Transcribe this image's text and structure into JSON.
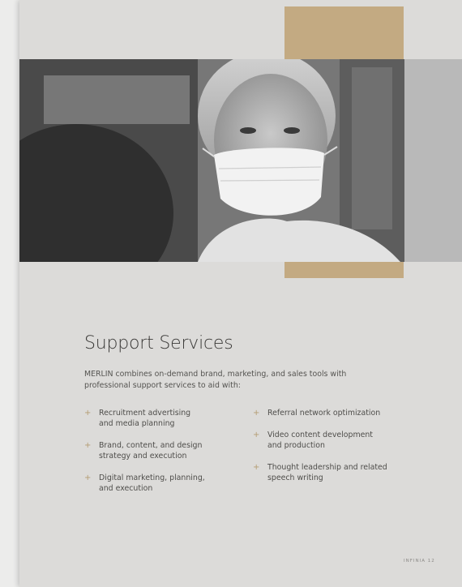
{
  "page": {
    "title": "Support Services",
    "intro": "MERLIN combines on-demand brand, marketing, and sales tools with professional support services to aid with:",
    "services_left": [
      {
        "bullet": "+",
        "text": "Recruitment advertising\nand media planning"
      },
      {
        "bullet": "+",
        "text": "Brand, content, and design\nstrategy and execution"
      },
      {
        "bullet": "+",
        "text": "Digital marketing, planning,\nand execution"
      }
    ],
    "services_right": [
      {
        "bullet": "+",
        "text": "Referral network optimization"
      },
      {
        "bullet": "+",
        "text": "Video content development\nand production"
      },
      {
        "bullet": "+",
        "text": "Thought leadership and related\nspeech writing"
      }
    ],
    "footer": "INFINIA  12"
  },
  "colors": {
    "accent": "#c3aa82",
    "page_background": "#dcdbd9",
    "title_text": "#3b3a38"
  },
  "image": {
    "description_icon": "photo-masked-healthcare-worker"
  }
}
